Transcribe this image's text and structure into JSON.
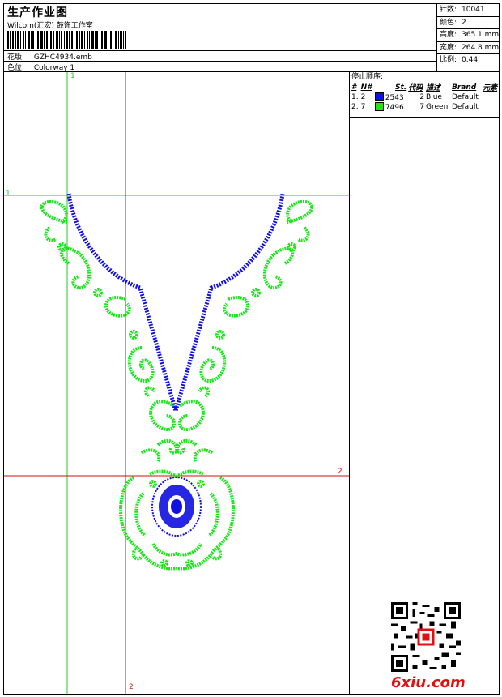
{
  "header": {
    "title": "生产作业图",
    "studio": "Wilcom(汇宏) 鼓饰工作室",
    "design_label": "花版:",
    "design_value": "GZHC4934.emb",
    "colorway_label": "色位:",
    "colorway_value": "Colorway 1"
  },
  "stats": [
    {
      "label": "针数:",
      "value": "10041"
    },
    {
      "label": "颜色:",
      "value": "2"
    },
    {
      "label": "高度:",
      "value": "365.1 mm"
    },
    {
      "label": "宽度:",
      "value": "264.8 mm"
    },
    {
      "label": "比例:",
      "value": "0.44"
    }
  ],
  "stop_sequence": {
    "title": "停止顺序:",
    "headers": [
      "#",
      "N#",
      "St.",
      "代码",
      "描述",
      "Brand",
      "元素"
    ],
    "rows": [
      {
        "index": "1.",
        "needle": "2",
        "color": "#1010e0",
        "stitches": "2543",
        "code": "2",
        "desc": "Blue",
        "brand": "Default"
      },
      {
        "index": "2.",
        "needle": "7",
        "color": "#19e619",
        "stitches": "7496",
        "code": "7",
        "desc": "Green",
        "brand": "Default"
      }
    ]
  },
  "axes": {
    "green_v": "1",
    "green_h": "1",
    "red_h": "2",
    "red_v": "2"
  },
  "watermark": "6xiu.com",
  "colors": {
    "blue": "#1010e0",
    "green": "#19e619",
    "axis_green": "#22cc22",
    "axis_red": "#cc1111"
  }
}
